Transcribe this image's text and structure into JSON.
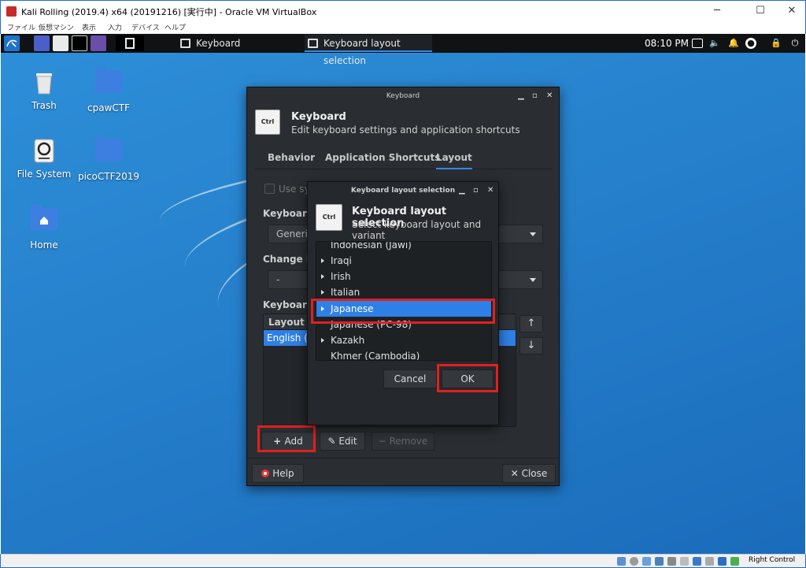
{
  "host": {
    "title": "Kali Rolling (2019.4) x64 (20191216) [実行中] - Oracle VM VirtualBox",
    "menu": [
      "ファイル",
      "仮想マシン",
      "表示",
      "入力",
      "デバイス",
      "ヘルプ"
    ],
    "minimize": "─",
    "maximize": "☐",
    "close": "✕",
    "host_key": "Right Control"
  },
  "panel": {
    "tasks": [
      "Keyboard",
      "Keyboard layout selection"
    ],
    "clock": "08:10 PM"
  },
  "desktop": {
    "icons": [
      {
        "label": "Trash"
      },
      {
        "label": "cpawCTF"
      },
      {
        "label": "File System"
      },
      {
        "label": "picoCTF2019"
      },
      {
        "label": "Home"
      }
    ]
  },
  "keyboard": {
    "window_title": "Keyboard",
    "icon_text": "Ctrl",
    "title": "Keyboard",
    "subtitle": "Edit keyboard settings and application shortcuts",
    "tabs": [
      "Behavior",
      "Application Shortcuts",
      "Layout"
    ],
    "use_system_defaults": "Use sys",
    "keyboard_model_label": "Keyboard n",
    "keyboard_model_value": "Generic",
    "change_layout_label": "Change lay",
    "change_layout_value": "-",
    "keyboard_layout_label": "Keyboard l",
    "list_header": "Layout",
    "list_selected": "English (U",
    "add": "Add",
    "edit": "Edit",
    "remove": "Remove",
    "help": "Help",
    "close": "Close"
  },
  "layout_selection": {
    "window_title": "Keyboard layout selection",
    "icon_text": "Ctrl",
    "title": "Keyboard layout selection",
    "subtitle": "Select keyboard layout and variant",
    "items": [
      {
        "label": "Indonesian (Jawi)",
        "expandable": false
      },
      {
        "label": "Iraqi",
        "expandable": true
      },
      {
        "label": "Irish",
        "expandable": true
      },
      {
        "label": "Italian",
        "expandable": true
      },
      {
        "label": "Japanese",
        "expandable": true
      },
      {
        "label": "Japanese (PC-98)",
        "expandable": false
      },
      {
        "label": "Kazakh",
        "expandable": true
      },
      {
        "label": "Khmer (Cambodia)",
        "expandable": false
      }
    ],
    "selected": "Japanese",
    "cancel": "Cancel",
    "ok": "OK"
  },
  "colors": {
    "accent": "#2f80e6",
    "highlight": "#e02020",
    "desktop": "#2680cc"
  }
}
